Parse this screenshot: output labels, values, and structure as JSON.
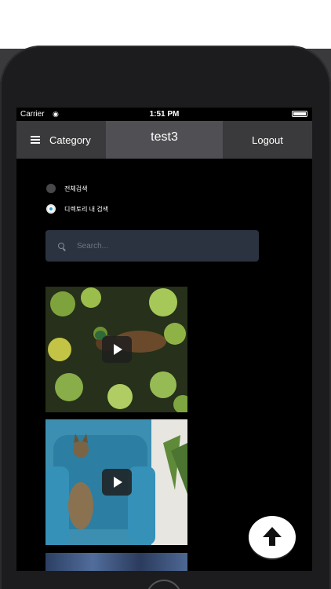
{
  "status_bar": {
    "carrier": "Carrier",
    "time": "1:51 PM"
  },
  "navbar": {
    "category_label": "Category",
    "title": "test3",
    "logout_label": "Logout"
  },
  "search_scope": {
    "options": [
      {
        "label": "전체검색",
        "selected": false
      },
      {
        "label": "디렉토리 내 검색",
        "selected": true
      }
    ]
  },
  "search": {
    "placeholder": "Search...",
    "value": ""
  },
  "media": [
    {
      "kind": "video",
      "subject": "duck-in-pond"
    },
    {
      "kind": "video",
      "subject": "cat-on-blue-armchair"
    },
    {
      "kind": "image",
      "subject": "blue-texture"
    }
  ],
  "colors": {
    "accent": "#2fa4d6",
    "navbar": "#3a3a3c",
    "nav_active": "#505054",
    "search_bg": "#2b3340"
  },
  "icons": [
    "menu-icon",
    "wifi-icon",
    "battery-icon",
    "search-icon",
    "play-icon",
    "arrow-up-icon"
  ]
}
